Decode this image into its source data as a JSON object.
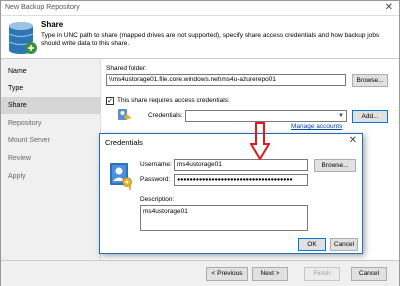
{
  "window": {
    "title": "New Backup Repository",
    "close": "✕"
  },
  "header": {
    "title": "Share",
    "description": "Type in UNC path to share (mapped drives are not supported), specify share access credentials and how backup jobs should write data to this share."
  },
  "sidebar": {
    "items": [
      {
        "label": "Name",
        "active": false,
        "enabled": true
      },
      {
        "label": "Type",
        "active": false,
        "enabled": true
      },
      {
        "label": "Share",
        "active": true,
        "enabled": true
      },
      {
        "label": "Repository",
        "active": false,
        "enabled": false
      },
      {
        "label": "Mount Server",
        "active": false,
        "enabled": false
      },
      {
        "label": "Review",
        "active": false,
        "enabled": false
      },
      {
        "label": "Apply",
        "active": false,
        "enabled": false
      }
    ]
  },
  "share": {
    "folder_label": "Shared folder:",
    "folder_value": "\\\\ms4ustorage01.file.core.windows.net\\ms4u-azurerepo01",
    "browse_label": "Browse...",
    "requires_creds_label": "This share requires access credentials:",
    "requires_creds_checked": true,
    "credentials_label": "Credentials:",
    "credentials_value": "",
    "add_label": "Add...",
    "manage_accounts_label": "Manage accounts"
  },
  "dialog": {
    "title": "Credentials",
    "close": "✕",
    "username_label": "Username:",
    "username_value": "ms4ustorage01",
    "username_browse": "Browse...",
    "password_label": "Password:",
    "password_value": "●●●●●●●●●●●●●●●●●●●●●●●●●●●●●●●●●●●●●",
    "description_label": "Description:",
    "description_value": "ms4ustorage01",
    "ok_label": "OK",
    "cancel_label": "Cancel"
  },
  "footer": {
    "previous_label": "< Previous",
    "next_label": "Next >",
    "finish_label": "Finish",
    "cancel_label": "Cancel"
  },
  "colors": {
    "accent": "#0078d7",
    "arrow": "#e01b1b",
    "link": "#0645ad"
  }
}
